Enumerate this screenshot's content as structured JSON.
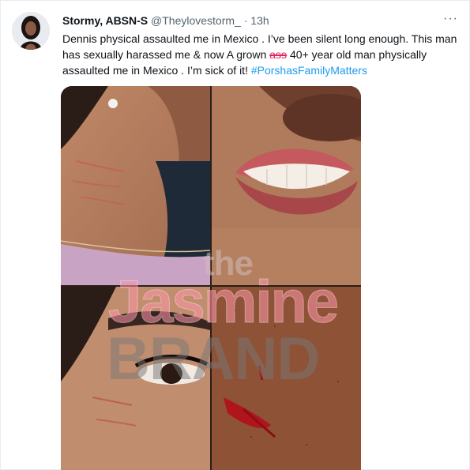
{
  "tweet": {
    "display_name": "Stormy, ABSN-S",
    "handle": "@Theylovestorm_",
    "separator": "·",
    "timestamp": "13h",
    "more_label": "···",
    "text_line1": "Dennis physical assaulted me in Mexico . I’ve been silent long enough. This man has sexually harassed me & now A grown ",
    "struck_word": "ass",
    "text_line2": " 40+ year old man physically assaulted me in Mexico . I’m sick of it! ",
    "hashtag": "#PorshasFamilyMatters"
  },
  "media": {
    "watermark_the": "the",
    "watermark_jasmine": "Jasmine",
    "watermark_brand": "BRAND"
  },
  "colors": {
    "link": "#1d9bf0",
    "text": "#0f1419",
    "secondary": "#536471"
  }
}
